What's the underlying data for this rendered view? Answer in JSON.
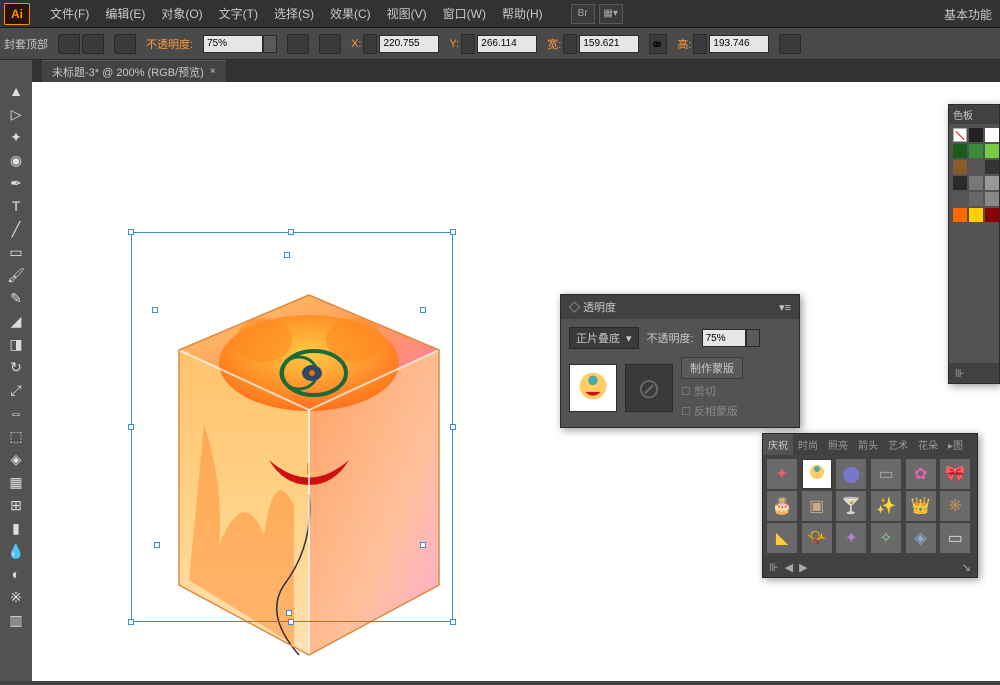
{
  "app": {
    "logo": "Ai",
    "essentials": "基本功能"
  },
  "menu": {
    "file": "文件(F)",
    "edit": "编辑(E)",
    "object": "对象(O)",
    "type": "文字(T)",
    "select": "选择(S)",
    "effect": "效果(C)",
    "view": "视图(V)",
    "window": "窗口(W)",
    "help": "帮助(H)"
  },
  "controlbar": {
    "mode": "封套顶部",
    "opacity_label": "不透明度:",
    "opacity_value": "75%",
    "x_label": "X:",
    "x_value": "220.755",
    "y_label": "Y:",
    "y_value": "266.114",
    "w_label": "宽:",
    "w_value": "159.621",
    "h_label": "高:",
    "h_value": "193.746"
  },
  "tab": {
    "title": "未标题-3* @ 200% (RGB/预览)"
  },
  "transparency": {
    "title": "透明度",
    "blend": "正片叠底",
    "opacity_label": "不透明度:",
    "opacity_value": "75%",
    "make_mask": "制作蒙版",
    "clip": "剪切",
    "invert": "反相蒙版"
  },
  "swatches": {
    "title": "色板",
    "colors": [
      "#ffffff",
      "#000000",
      "#1a5c1a",
      "#77cc44",
      "#8b5a2b",
      "#555555",
      "#333333",
      "#2a2a2a",
      "#777777",
      "#999999",
      "#555555",
      "#ff6a00",
      "#ffd000",
      "#8b0000"
    ]
  },
  "symbols": {
    "tabs": {
      "celebrate": "庆祝",
      "fashion": "时尚",
      "lights": "照亮",
      "arrows": "箭头",
      "art": "艺术",
      "flowers": "花朵",
      "map": "图"
    },
    "items": [
      "✦",
      "🎈",
      "🎈",
      "📋",
      "🌸",
      "🎀",
      "🎂",
      "🍰",
      "🍸",
      "✨",
      "👑",
      "✨",
      "🔔",
      "📯",
      "🎊",
      "✨",
      "🪁",
      "📄"
    ]
  }
}
